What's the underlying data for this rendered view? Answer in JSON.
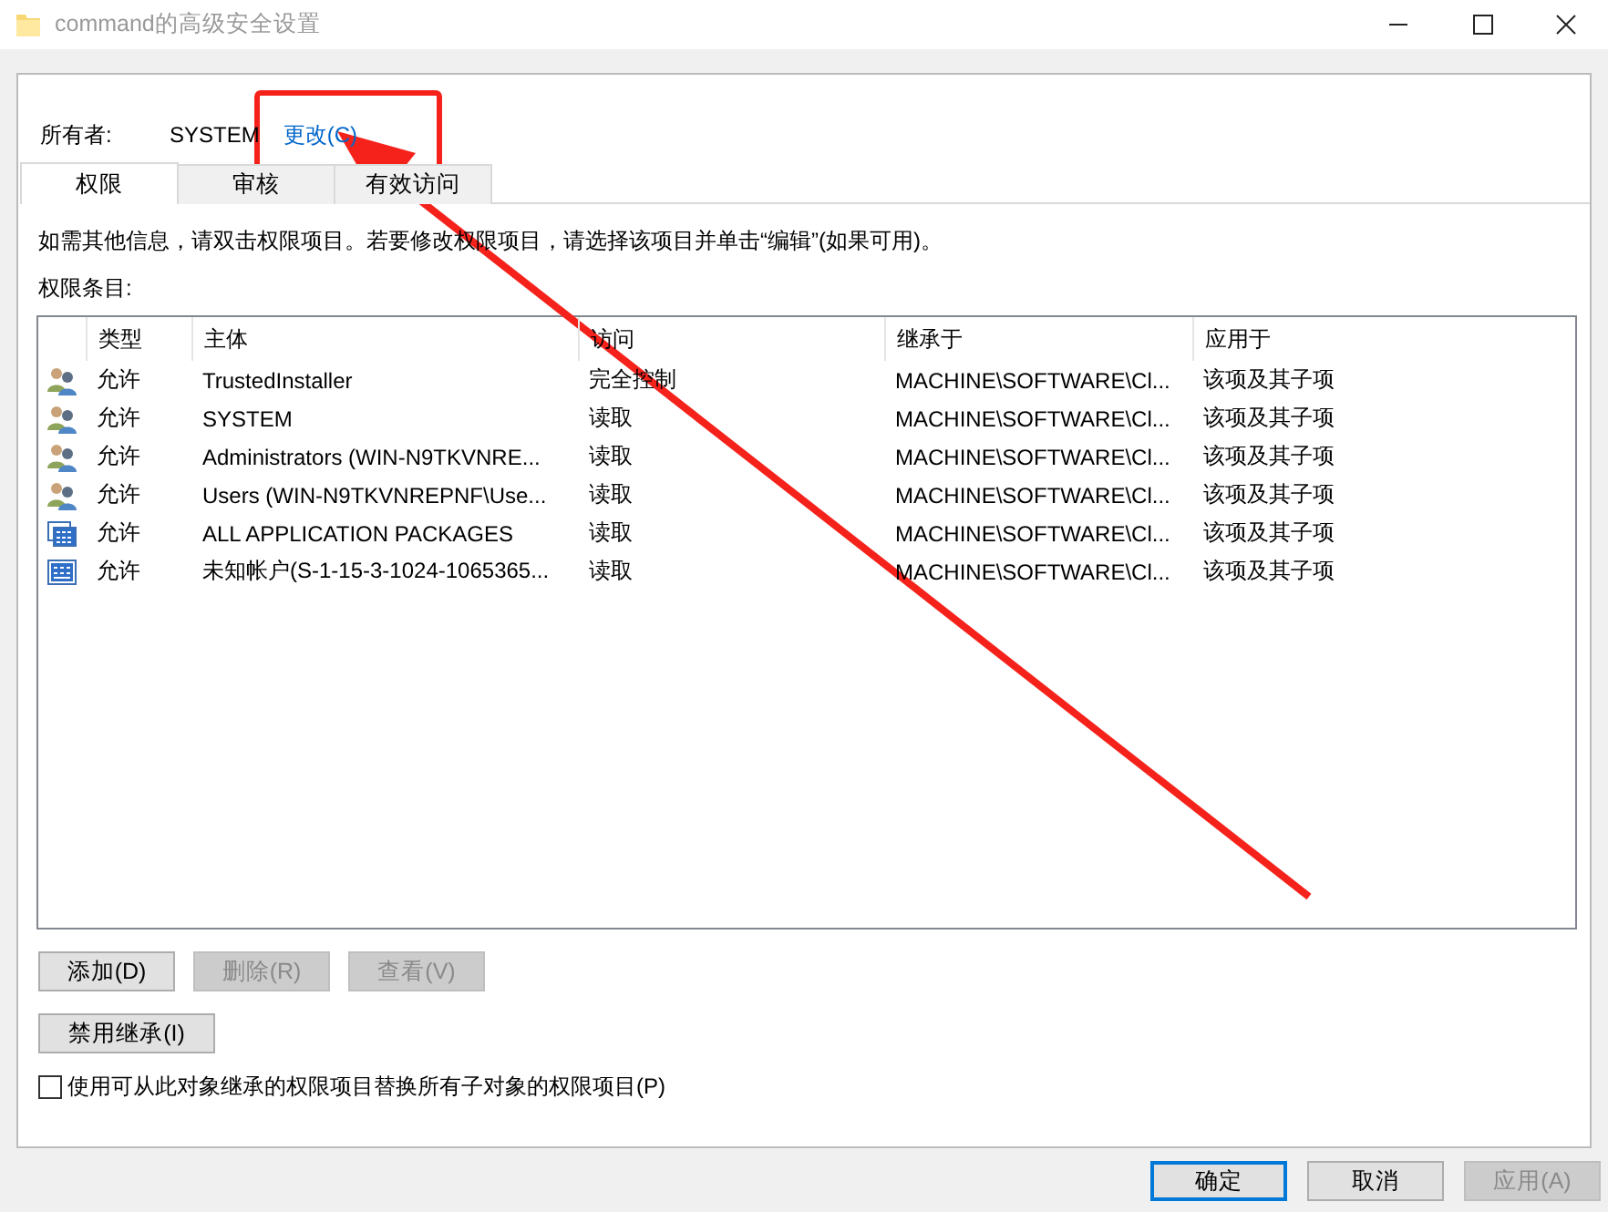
{
  "window": {
    "title": "command的高级安全设置"
  },
  "owner": {
    "label": "所有者:",
    "value": "SYSTEM",
    "link": "更改(C)"
  },
  "tabs": [
    {
      "label": "权限",
      "selected": true
    },
    {
      "label": "审核",
      "selected": false
    },
    {
      "label": "有效访问",
      "selected": false
    }
  ],
  "info_text": "如需其他信息，请双击权限项目。若要修改权限项目，请选择该项目并单击“编辑”(如果可用)。",
  "entries_label": "权限条目:",
  "table": {
    "columns": [
      "类型",
      "主体",
      "访问",
      "继承于",
      "应用于"
    ],
    "rows": [
      {
        "kind": "group",
        "cells": [
          "允许",
          "TrustedInstaller",
          "完全控制",
          "MACHINE\\SOFTWARE\\Cl...",
          "该项及其子项"
        ]
      },
      {
        "kind": "group",
        "cells": [
          "允许",
          "SYSTEM",
          "读取",
          "MACHINE\\SOFTWARE\\Cl...",
          "该项及其子项"
        ]
      },
      {
        "kind": "group",
        "cells": [
          "允许",
          "Administrators (WIN-N9TKVNRE...",
          "读取",
          "MACHINE\\SOFTWARE\\Cl...",
          "该项及其子项"
        ]
      },
      {
        "kind": "group",
        "cells": [
          "允许",
          "Users (WIN-N9TKVNREPNF\\Use...",
          "读取",
          "MACHINE\\SOFTWARE\\Cl...",
          "该项及其子项"
        ]
      },
      {
        "kind": "package",
        "cells": [
          "允许",
          "ALL APPLICATION PACKAGES",
          "读取",
          "MACHINE\\SOFTWARE\\Cl...",
          "该项及其子项"
        ]
      },
      {
        "kind": "unknown",
        "cells": [
          "允许",
          "未知帐户(S-1-15-3-1024-1065365...",
          "读取",
          "MACHINE\\SOFTWARE\\Cl...",
          "该项及其子项"
        ]
      }
    ]
  },
  "entry_buttons": [
    {
      "label": "添加(D)",
      "disabled": false
    },
    {
      "label": "删除(R)",
      "disabled": true
    },
    {
      "label": "查看(V)",
      "disabled": true
    }
  ],
  "inherit_button": {
    "label": "禁用继承(I)",
    "disabled": false
  },
  "replace_checkbox": {
    "label": "使用可从此对象继承的权限项目替换所有子对象的权限项目(P)",
    "checked": false
  },
  "dialog_buttons": [
    {
      "label": "确定",
      "disabled": false,
      "focused": true
    },
    {
      "label": "取消",
      "disabled": false,
      "focused": false
    },
    {
      "label": "应用(A)",
      "disabled": true,
      "focused": false
    }
  ]
}
